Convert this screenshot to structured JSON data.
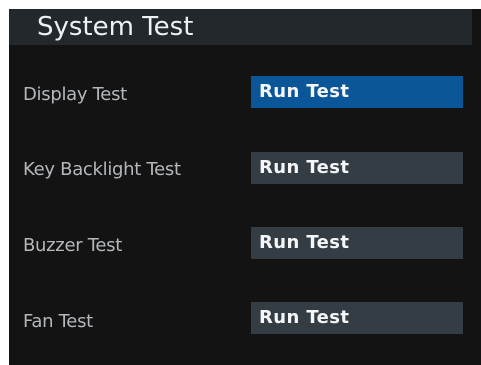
{
  "screen": {
    "title": "System Test"
  },
  "tests": [
    {
      "label": "Display Test",
      "button": "Run Test",
      "selected": true
    },
    {
      "label": "Key Backlight Test",
      "button": "Run Test",
      "selected": false
    },
    {
      "label": "Buzzer Test",
      "button": "Run Test",
      "selected": false
    },
    {
      "label": "Fan Test",
      "button": "Run Test",
      "selected": false
    }
  ],
  "colors": {
    "background": "#131313",
    "title_bar": "#23282d",
    "button": "#343c44",
    "button_selected": "#0a5698"
  }
}
